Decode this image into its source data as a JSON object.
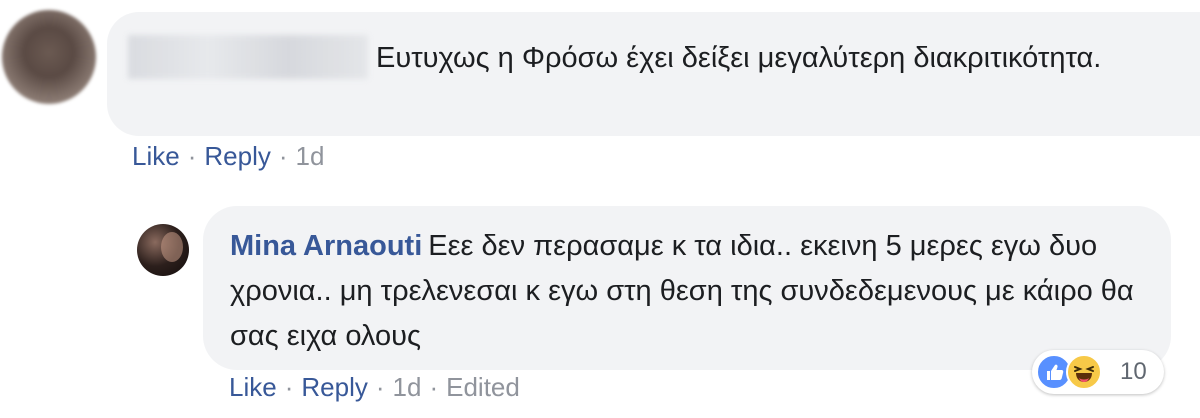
{
  "comment_1": {
    "text": "Ευτυχως η Φρόσω έχει δείξει μεγαλύτερη διακριτικότητα.",
    "actions": {
      "like": "Like",
      "reply": "Reply",
      "time": "1d"
    }
  },
  "comment_2": {
    "author": "Mina Arnaouti",
    "text": "Εεε δεν περασαμε κ τα ιδια.. εκεινη 5 μερες εγω δυο χρονια.. μη τρελενεσαι κ εγω στη θεση της συνδεδεμενους με κάιρο θα σας ειχα ολους",
    "actions": {
      "like": "Like",
      "reply": "Reply",
      "time": "1d",
      "edited": "Edited"
    },
    "reactions": {
      "icons": [
        "like-icon",
        "haha-icon"
      ],
      "count": "10"
    }
  },
  "actions_separator": "·",
  "colors": {
    "bubble": "#f2f3f5",
    "link": "#385898",
    "text": "#1c1e21",
    "meta": "#90949c",
    "like_blue": "#5890ff",
    "haha_yellow": "#f7c948"
  }
}
